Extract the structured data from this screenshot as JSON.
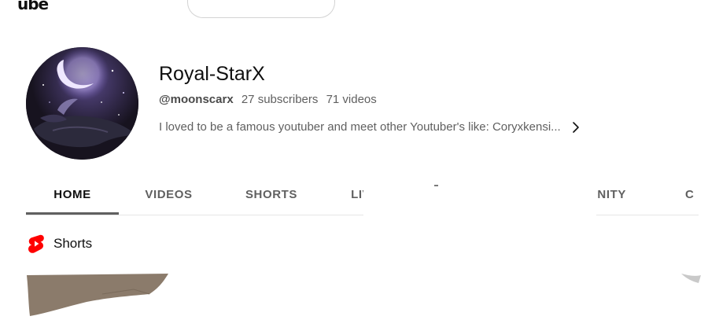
{
  "header": {
    "logo_fragment": "ube"
  },
  "channel": {
    "name": "Royal-StarX",
    "handle": "@moonscarx",
    "subscribers": "27 subscribers",
    "videos": "71 videos",
    "description": "I loved to be a famous youtuber and meet other Youtuber's like: Coryxkensi..."
  },
  "tabs": [
    {
      "label": "HOME",
      "active": true
    },
    {
      "label": "VIDEOS",
      "active": false
    },
    {
      "label": "SHORTS",
      "active": false
    },
    {
      "label": "LIVE",
      "active": false
    },
    {
      "label": "UNITY",
      "active": false
    },
    {
      "label": "C",
      "active": false
    }
  ],
  "shorts_section": {
    "title": "Shorts",
    "icon": "youtube-shorts-icon",
    "icon_color": "#ff0000"
  },
  "colors": {
    "accent": "#ff0000",
    "text_primary": "#0f0f0f",
    "text_secondary": "#606060",
    "active_tab_underline": "#606060",
    "thumbnail_tone": "#8b7b6b"
  }
}
